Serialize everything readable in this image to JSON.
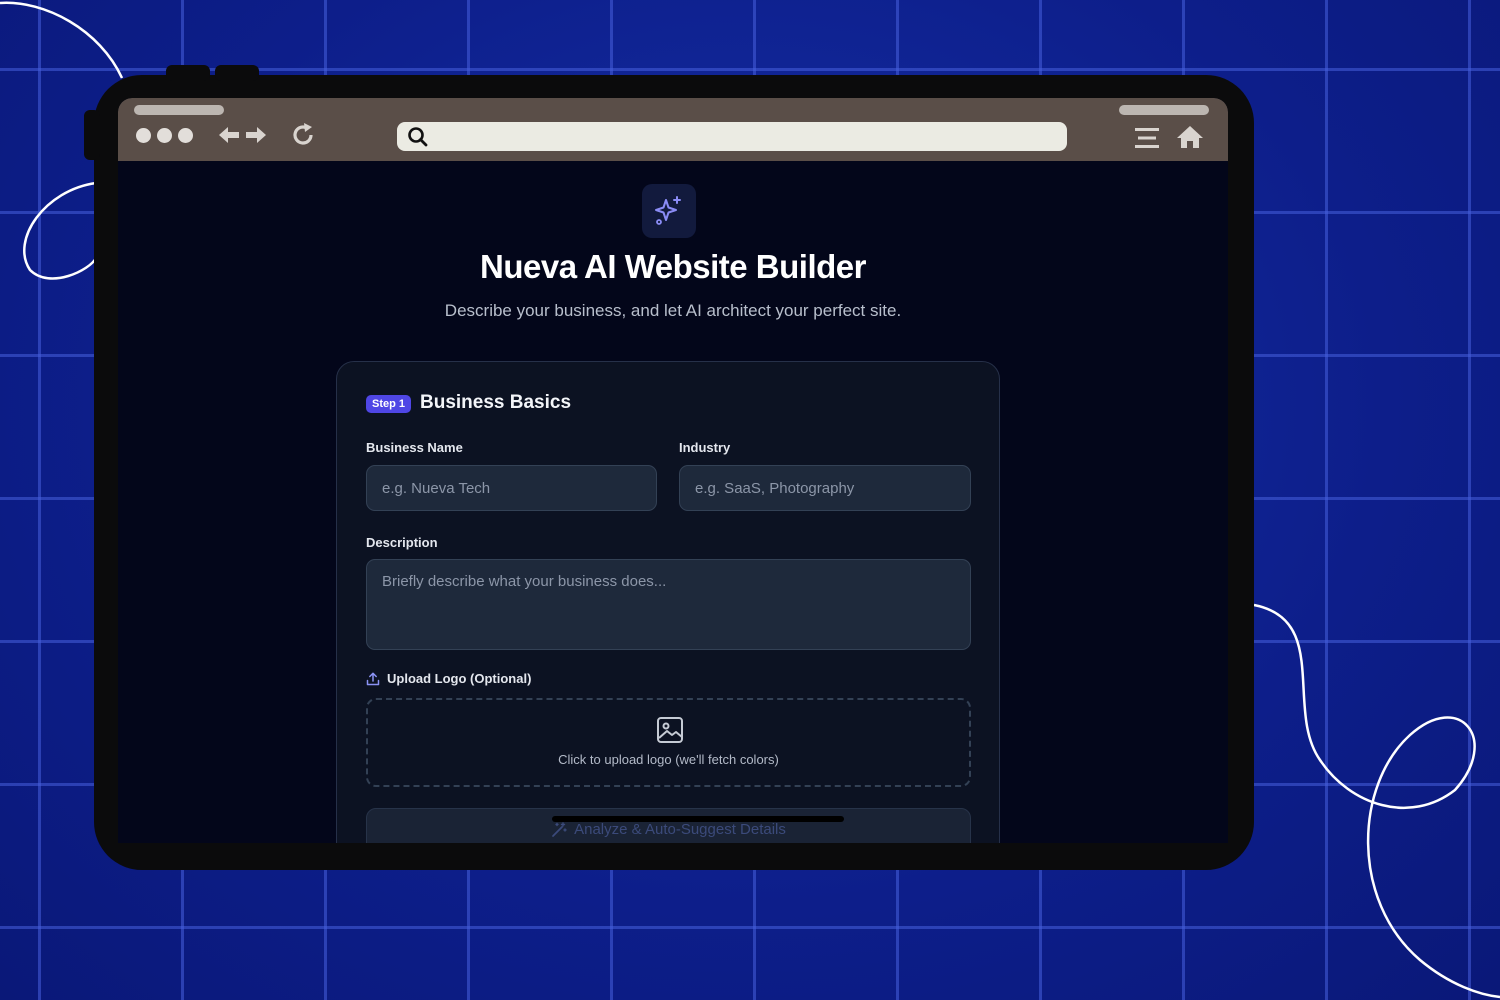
{
  "browser": {
    "url": ""
  },
  "page": {
    "title": "Nueva AI Website Builder",
    "subtitle": "Describe your business, and let AI architect your perfect site."
  },
  "form": {
    "step_badge": "Step 1",
    "section_title": "Business Basics",
    "business_name": {
      "label": "Business Name",
      "placeholder": "e.g. Nueva Tech",
      "value": ""
    },
    "industry": {
      "label": "Industry",
      "placeholder": "e.g. SaaS, Photography",
      "value": ""
    },
    "description": {
      "label": "Description",
      "placeholder": "Briefly describe what your business does...",
      "value": ""
    },
    "upload": {
      "label": "Upload Logo (Optional)",
      "hint": "Click to upload logo (we'll fetch colors)"
    },
    "analyze_button": "Analyze & Auto-Suggest Details"
  },
  "icons": [
    "sparkles-icon",
    "upload-icon",
    "image-icon",
    "wand-icon",
    "search-icon",
    "back-arrow-icon",
    "forward-arrow-icon",
    "reload-icon",
    "menu-icon",
    "home-icon"
  ],
  "colors": {
    "background": "#0f1f8f",
    "screen": "#03061a",
    "card": "#0c1222",
    "accent": "#4f46e5",
    "browser_chrome": "#5a4e48"
  }
}
